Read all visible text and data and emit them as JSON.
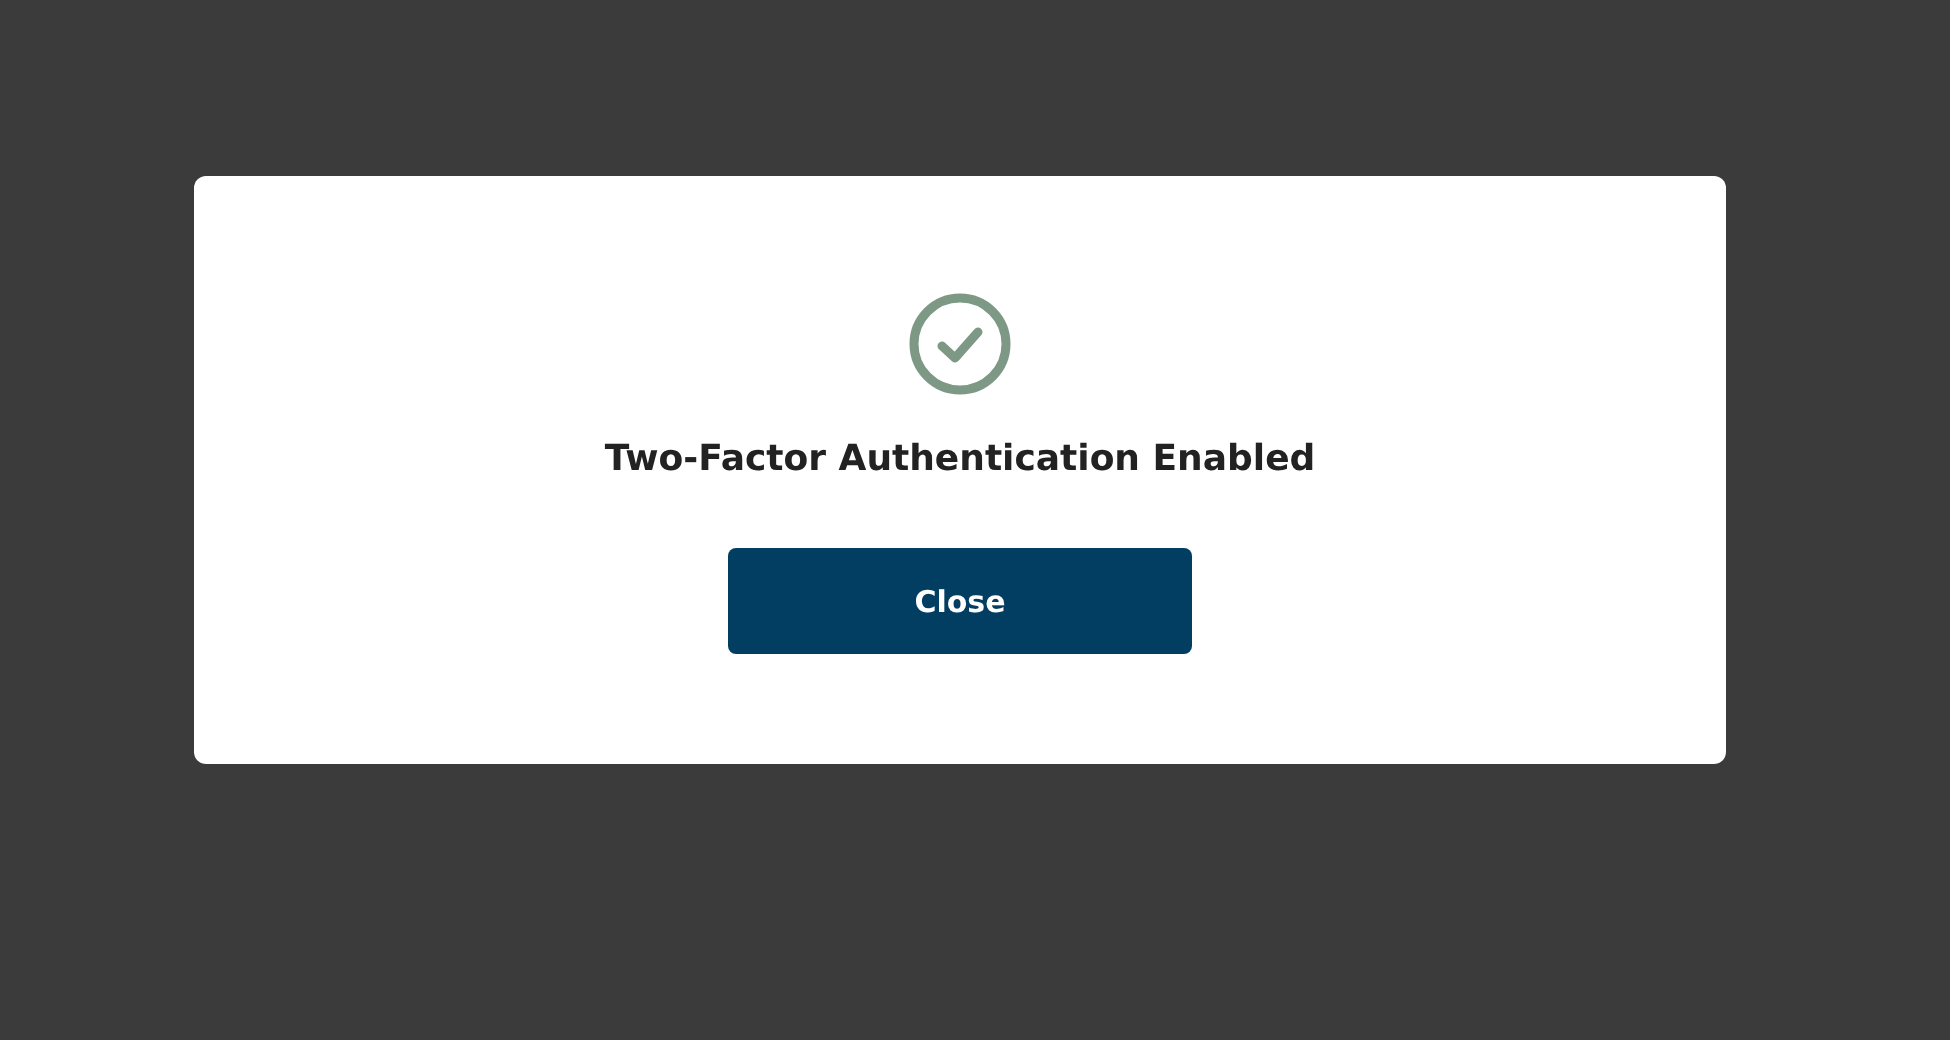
{
  "dialog": {
    "success": true,
    "title": "Two-Factor Authentication Enabled",
    "button": "Close"
  }
}
